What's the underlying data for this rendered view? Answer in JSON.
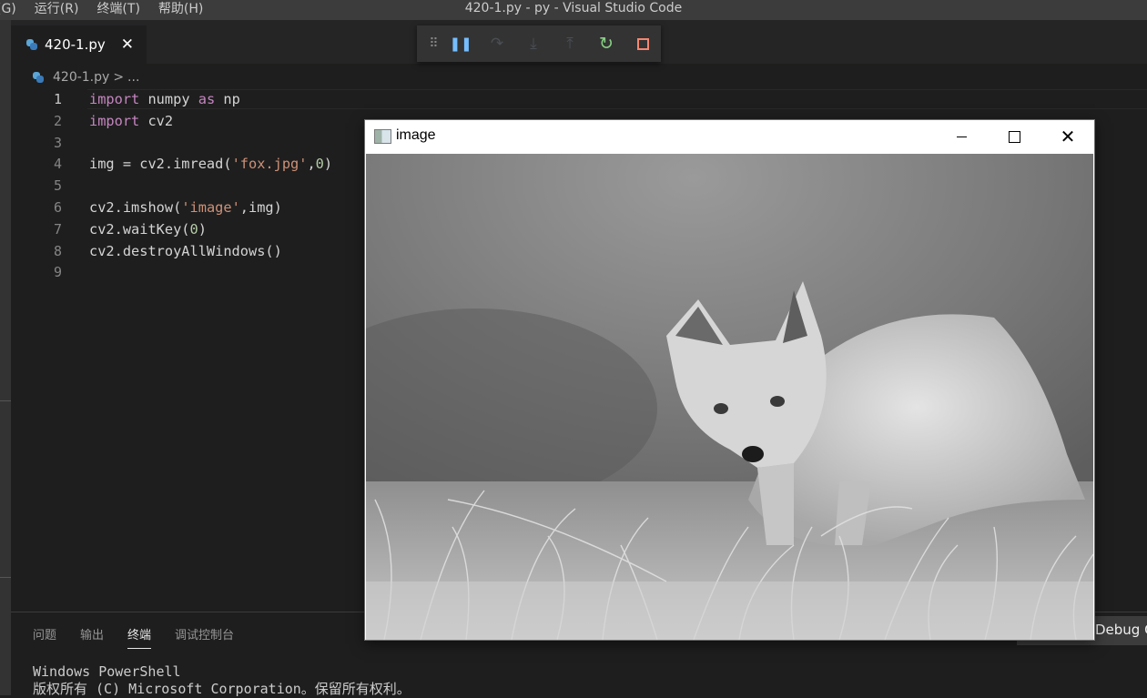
{
  "menu": {
    "items": [
      "(G)",
      "运行(R)",
      "终端(T)",
      "帮助(H)"
    ]
  },
  "window": {
    "title": "420-1.py - py - Visual Studio Code"
  },
  "tab": {
    "label": "420-1.py",
    "close_icon": "close-icon"
  },
  "debug_toolbar": {
    "buttons": [
      "drag-handle-icon",
      "pause-icon",
      "step-over-icon",
      "step-into-icon",
      "step-out-icon",
      "restart-icon",
      "stop-icon"
    ]
  },
  "breadcrumb": {
    "file": "420-1.py",
    "separator": ">",
    "more": "..."
  },
  "editor": {
    "line_numbers": [
      "1",
      "2",
      "3",
      "4",
      "5",
      "6",
      "7",
      "8",
      "9"
    ],
    "active_line": "1",
    "lines": [
      [
        {
          "t": "import",
          "c": "kw"
        },
        {
          "t": " numpy ",
          "c": ""
        },
        {
          "t": "as",
          "c": "kw"
        },
        {
          "t": " np",
          "c": ""
        }
      ],
      [
        {
          "t": "import",
          "c": "kw"
        },
        {
          "t": " cv2",
          "c": ""
        }
      ],
      [],
      [
        {
          "t": "img = cv2.imread(",
          "c": ""
        },
        {
          "t": "'fox.jpg'",
          "c": "str"
        },
        {
          "t": ",",
          "c": ""
        },
        {
          "t": "0",
          "c": "num"
        },
        {
          "t": ")",
          "c": ""
        }
      ],
      [],
      [
        {
          "t": "cv2.imshow(",
          "c": ""
        },
        {
          "t": "'image'",
          "c": "str"
        },
        {
          "t": ",img)",
          "c": ""
        }
      ],
      [
        {
          "t": "cv2.waitKey(",
          "c": ""
        },
        {
          "t": "0",
          "c": "num"
        },
        {
          "t": ")",
          "c": ""
        }
      ],
      [
        {
          "t": "cv2.destroyAllWindows()",
          "c": ""
        }
      ],
      []
    ]
  },
  "panel": {
    "tabs": [
      "问题",
      "输出",
      "终端",
      "调试控制台"
    ],
    "active_tab": "终端",
    "terminal_lines": [
      "Windows PowerShell",
      "版权所有 (C) Microsoft Corporation。保留所有权利。"
    ],
    "dropdown_label": "Debug C"
  },
  "cv_window": {
    "title": "image",
    "image": "grayscale-fox-photo"
  },
  "colors": {
    "editor_bg": "#1e1e1e",
    "keyword": "#c586c0",
    "string": "#ce9178",
    "number": "#b5cea8",
    "pause": "#75beff",
    "restart": "#89d185",
    "stop": "#f48771"
  }
}
